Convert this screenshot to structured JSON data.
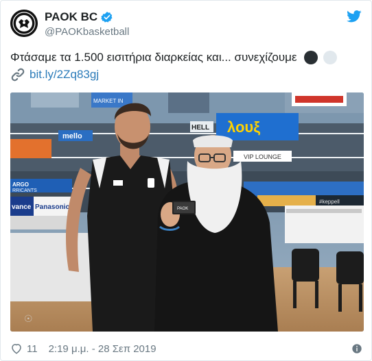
{
  "tweet": {
    "display_name": "PAOK BC",
    "handle": "@PAOKbasketball",
    "text": "Φτάσαμε τα 1.500 εισιτήρια διαρκείας και... συνεχίζουμε",
    "link": "bit.ly/2Zq83gj",
    "likes": "11",
    "timestamp": "2:19 μ.μ. - 28 Σεπ 2019"
  },
  "photo": {
    "banner_left": "mello",
    "banner_lous": "λουξ",
    "banner_vip": "VIP LOUNGE",
    "banner_hell": "HELL",
    "banner_argo": "ARGO",
    "banner_argo2": "RRICANTS",
    "banner_panasonic": "Panasonic",
    "banner_vance": "vance",
    "banner_keppel": "#keppell",
    "banner_marketin": "MARKET IN",
    "card_text": "PAOK"
  },
  "colors": {
    "accent": "#1da1f2",
    "link": "#2b7bb9",
    "muted": "#697882"
  },
  "icons": {
    "verified": "verified-badge-icon",
    "bird": "twitter-bird-icon",
    "link": "link-icon",
    "heart": "heart-icon",
    "info": "info-icon"
  }
}
